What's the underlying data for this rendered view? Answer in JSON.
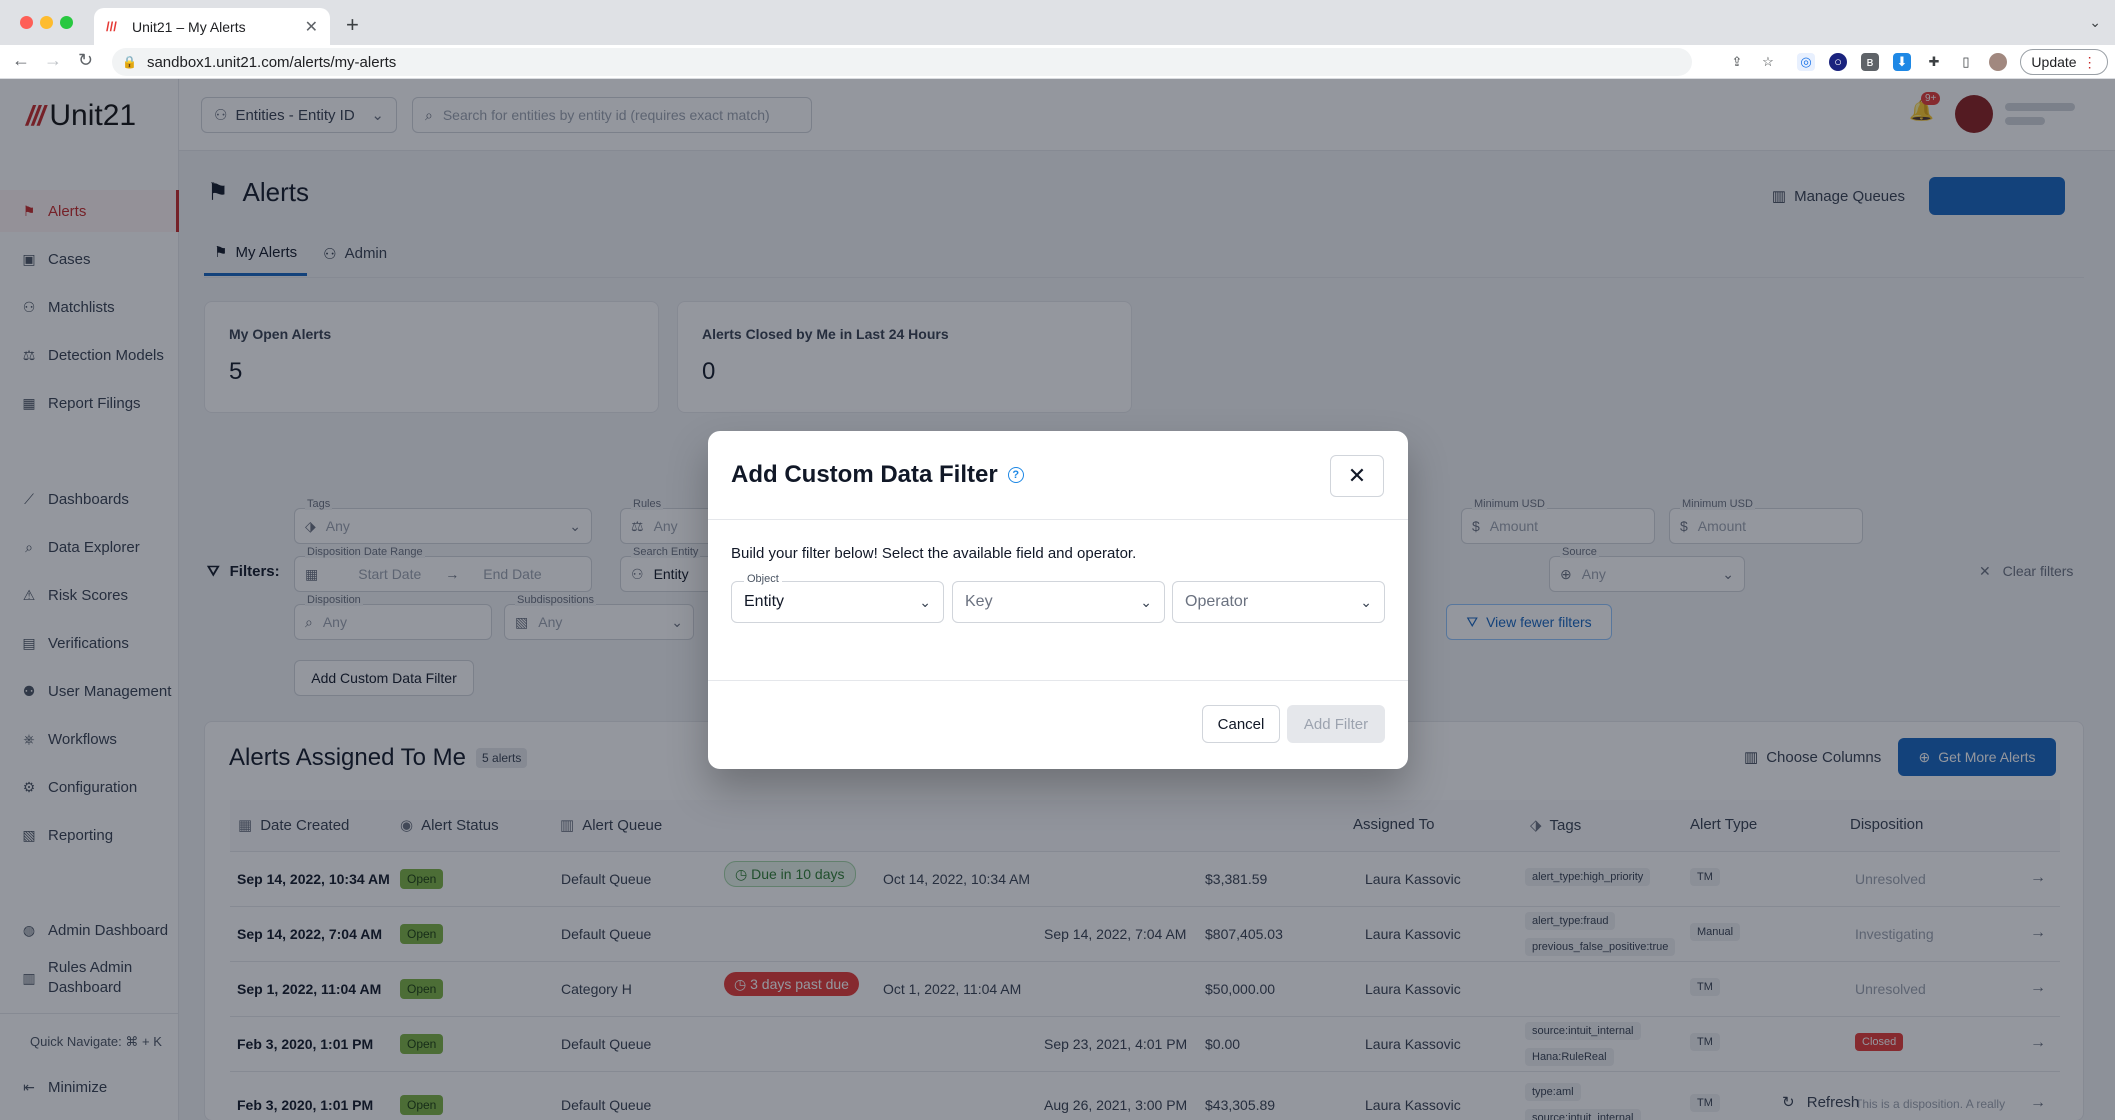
{
  "browser": {
    "tab_title": "Unit21 – My Alerts",
    "url": "sandbox1.unit21.com/alerts/my-alerts",
    "update_label": "Update"
  },
  "app": {
    "logo_text": "Unit21",
    "accent_color": "#c62828",
    "primary_color": "#1565c0"
  },
  "sidebar": {
    "items": [
      {
        "label": "Alerts",
        "icon": "flag-icon"
      },
      {
        "label": "Cases",
        "icon": "briefcase-icon"
      },
      {
        "label": "Matchlists",
        "icon": "user-plus-icon"
      },
      {
        "label": "Detection Models",
        "icon": "scale-icon"
      },
      {
        "label": "Report Filings",
        "icon": "building-icon"
      },
      {
        "label": "Dashboards",
        "icon": "chart-line-icon"
      },
      {
        "label": "Data Explorer",
        "icon": "search-list-icon"
      },
      {
        "label": "Risk Scores",
        "icon": "warning-icon"
      },
      {
        "label": "Verifications",
        "icon": "id-card-icon"
      },
      {
        "label": "User Management",
        "icon": "users-icon"
      },
      {
        "label": "Workflows",
        "icon": "workflow-icon"
      },
      {
        "label": "Configuration",
        "icon": "gear-icon"
      },
      {
        "label": "Reporting",
        "icon": "report-icon"
      },
      {
        "label": "Admin Dashboard",
        "icon": "globe-icon"
      },
      {
        "label": "Rules Admin Dashboard",
        "icon": "clipboard-icon"
      }
    ],
    "quick_navigate": "Quick Navigate: ⌘ + K",
    "minimize": "Minimize"
  },
  "topbar": {
    "entity_select": "Entities - Entity ID",
    "search_placeholder": "Search for entities by entity id (requires exact match)"
  },
  "page": {
    "title": "Alerts",
    "manage_queues": "Manage Queues",
    "tabs": [
      {
        "label": "My Alerts"
      },
      {
        "label": "Admin"
      }
    ],
    "stats": [
      {
        "label": "My Open Alerts",
        "value": "5"
      },
      {
        "label": "Alerts Closed by Me in Last 24 Hours",
        "value": "0"
      }
    ]
  },
  "filters": {
    "label": "Filters:",
    "tags_caption": "Tags",
    "tags_value": "Any",
    "rules_caption": "Rules",
    "rules_value": "Any",
    "min_usd_caption_1": "Minimum USD",
    "min_usd_caption_2": "Minimum USD",
    "amount_placeholder": "Amount",
    "disposition_range_caption": "Disposition Date Range",
    "start_date": "Start Date",
    "end_date": "End Date",
    "search_entity_caption": "Search Entity",
    "search_entity_value": "Entity",
    "source_caption": "Source",
    "source_value": "Any",
    "clear_all": "Clear filters",
    "disposition_caption": "Disposition",
    "disposition_value": "Any",
    "subdispositions_caption": "Subdispositions",
    "subdispositions_value": "Any",
    "view_fewer": "View fewer filters",
    "add_custom": "Add Custom Data Filter"
  },
  "table": {
    "title": "Alerts Assigned To Me",
    "count": "5 alerts",
    "choose_columns": "Choose Columns",
    "get_more": "Get More Alerts",
    "refresh": "Refresh",
    "headers": {
      "date_created": "Date Created",
      "alert_status": "Alert Status",
      "alert_queue": "Alert Queue",
      "assigned_to": "Assigned To",
      "tags": "Tags",
      "alert_type": "Alert Type",
      "disposition": "Disposition"
    },
    "rows": [
      {
        "date": "Sep 14, 2022, 10:34 AM",
        "status": "Open",
        "queue": "Default Queue",
        "due": "Due in 10 days",
        "due_date": "Oct 14, 2022, 10:34 AM",
        "disp_date": "",
        "amount": "$3,381.59",
        "assignee": "Laura Kassovic",
        "tags": [
          "alert_type:high_priority"
        ],
        "type": "TM",
        "disposition": "Unresolved"
      },
      {
        "date": "Sep 14, 2022, 7:04 AM",
        "status": "Open",
        "queue": "Default Queue",
        "due": "",
        "due_date": "",
        "disp_date": "Sep 14, 2022, 7:04 AM",
        "amount": "$807,405.03",
        "assignee": "Laura Kassovic",
        "tags": [
          "alert_type:fraud",
          "previous_false_positive:true"
        ],
        "type": "Manual",
        "disposition": "Investigating"
      },
      {
        "date": "Sep 1, 2022, 11:04 AM",
        "status": "Open",
        "queue": "Category H",
        "due": "3 days past due",
        "due_date": "Oct 1, 2022, 11:04 AM",
        "disp_date": "",
        "amount": "$50,000.00",
        "assignee": "Laura Kassovic",
        "tags": [],
        "type": "TM",
        "disposition": "Unresolved"
      },
      {
        "date": "Feb 3, 2020, 1:01 PM",
        "status": "Open",
        "queue": "Default Queue",
        "due": "",
        "due_date": "",
        "disp_date": "Sep 23, 2021, 4:01 PM",
        "amount": "$0.00",
        "assignee": "Laura Kassovic",
        "tags": [
          "source:intuit_internal",
          "Hana:RuleReal"
        ],
        "type": "TM",
        "disposition": "Closed"
      },
      {
        "date": "Feb 3, 2020, 1:01 PM",
        "status": "Open",
        "queue": "Default Queue",
        "due": "",
        "due_date": "",
        "disp_date": "Aug 26, 2021, 3:00 PM",
        "amount": "$43,305.89",
        "assignee": "Laura Kassovic",
        "tags": [
          "type:aml",
          "source:intuit_internal"
        ],
        "type": "TM",
        "disposition": "This is a disposition. A really"
      }
    ]
  },
  "modal": {
    "title": "Add Custom Data Filter",
    "description": "Build your filter below! Select the available field and operator.",
    "object_caption": "Object",
    "object_value": "Entity",
    "key_placeholder": "Key",
    "operator_placeholder": "Operator",
    "cancel": "Cancel",
    "add_filter": "Add Filter"
  }
}
